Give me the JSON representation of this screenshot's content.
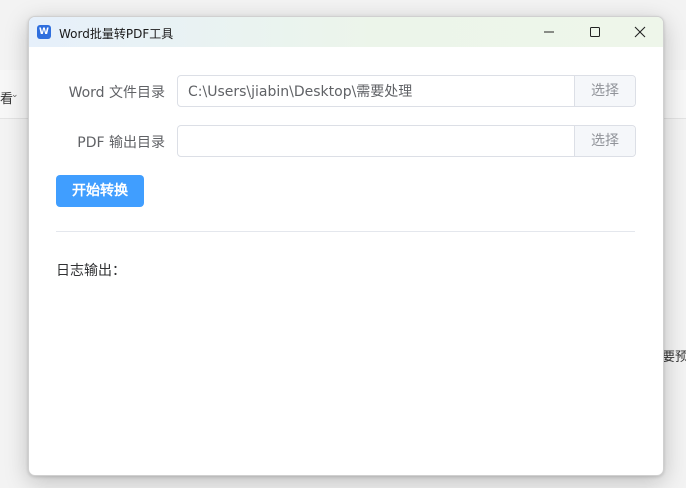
{
  "background": {
    "left_text": "看",
    "left_chevron": "⌄",
    "right_text": "要预"
  },
  "window": {
    "title": "Word批量转PDF工具",
    "icon_letter": "W",
    "controls": {
      "minimize": "minimize-icon",
      "maximize": "maximize-icon",
      "close": "close-icon"
    }
  },
  "form": {
    "word_dir": {
      "label": "Word 文件目录",
      "value": "C:\\Users\\jiabin\\Desktop\\需要处理",
      "button": "选择"
    },
    "pdf_dir": {
      "label": "PDF 输出目录",
      "value": "",
      "button": "选择"
    },
    "start_button": "开始转换"
  },
  "log": {
    "label": "日志输出："
  },
  "colors": {
    "primary": "#409eff",
    "border": "#dcdfe6",
    "label_text": "#606266"
  }
}
